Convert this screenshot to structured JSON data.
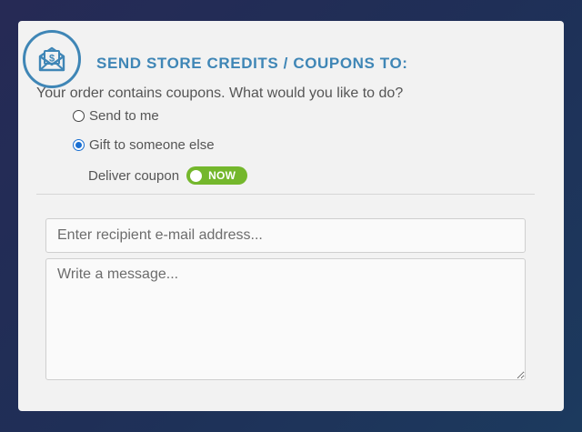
{
  "header": {
    "icon": "envelope-dollar-icon",
    "title": "SEND STORE CREDITS / COUPONS TO:"
  },
  "question": "Your order contains coupons. What would you like to do?",
  "options": [
    {
      "label": "Send to me",
      "selected": false
    },
    {
      "label": "Gift to someone else",
      "selected": true
    }
  ],
  "deliver": {
    "label": "Deliver coupon",
    "toggle_label": "NOW",
    "toggle_on": true
  },
  "form": {
    "email_placeholder": "Enter recipient e-mail address...",
    "email_value": "",
    "message_placeholder": "Write a message...",
    "message_value": ""
  },
  "colors": {
    "accent": "#3f86b6",
    "toggle": "#74b72c",
    "radio_checked": "#1a6fd1"
  }
}
